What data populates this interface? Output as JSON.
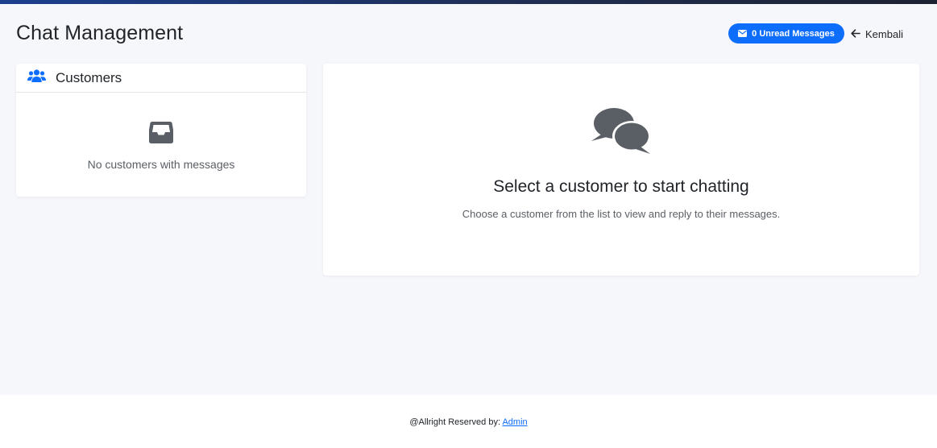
{
  "header": {
    "title": "Chat Management",
    "unread_button_label": "0 Unread Messages",
    "back_label": "Kembali"
  },
  "customers": {
    "title": "Customers",
    "empty_message": "No customers with messages"
  },
  "chat": {
    "placeholder_title": "Select a customer to start chatting",
    "placeholder_subtitle": "Choose a customer from the list to view and reply to their messages."
  },
  "footer": {
    "text": "@Allright Reserved by:",
    "link_label": "Admin"
  },
  "icons": {
    "envelope": "envelope-icon",
    "arrow_left": "arrow-left-icon",
    "users": "users-icon",
    "inbox": "inbox-icon",
    "comments": "comments-icon"
  },
  "colors": {
    "accent": "#0d6efd",
    "page_background": "#f6f7fb",
    "icon_gray": "#5a5f66"
  }
}
